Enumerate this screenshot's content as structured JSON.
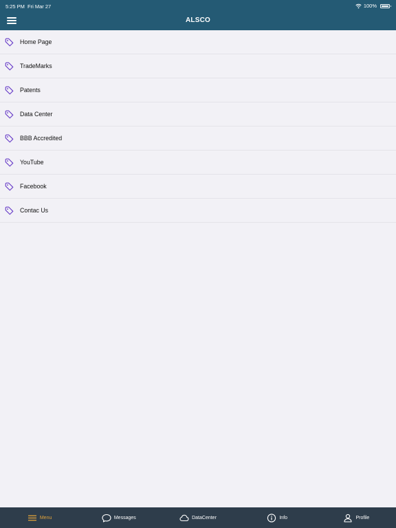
{
  "status": {
    "time": "5:25 PM",
    "date": "Fri Mar 27",
    "battery": "100%"
  },
  "header": {
    "title": "ALSCO"
  },
  "menu": [
    {
      "label": "Home Page"
    },
    {
      "label": "TradeMarks"
    },
    {
      "label": "Patents"
    },
    {
      "label": "Data Center"
    },
    {
      "label": "BBB Accredited"
    },
    {
      "label": "YouTube"
    },
    {
      "label": "Facebook"
    },
    {
      "label": "Contac Us"
    }
  ],
  "tabs": {
    "menu": "Menu",
    "messages": "Messages",
    "datacenter": "DataCenter",
    "info": "Info",
    "profile": "Profile"
  },
  "colors": {
    "header": "#245a74",
    "tabbar": "#2e3d4b",
    "accent": "#e0a23a",
    "icon": "#6a3fc8"
  }
}
